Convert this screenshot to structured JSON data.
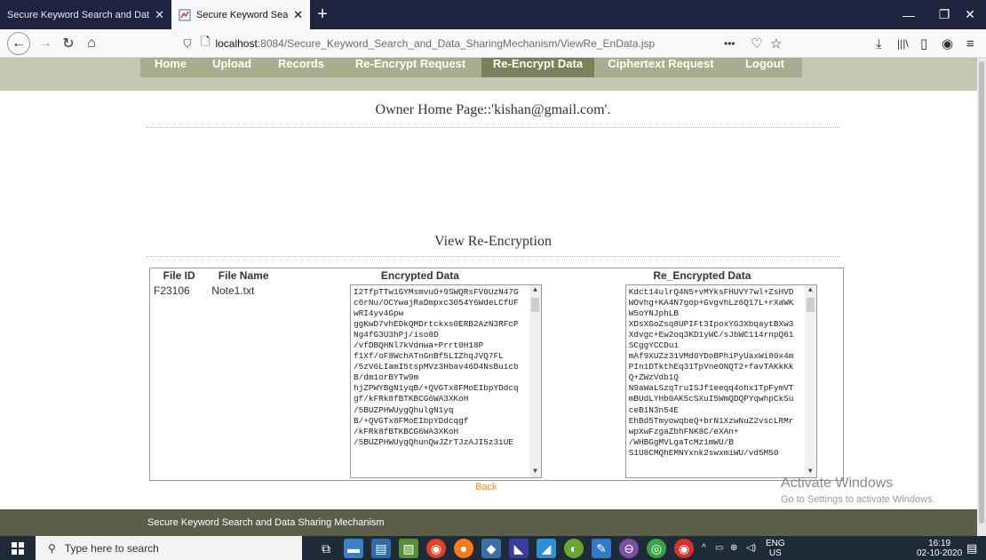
{
  "browser": {
    "tabs": [
      {
        "title": "Secure Keyword Search and Data Sh",
        "active": false
      },
      {
        "title": "Secure Keyword Search",
        "active": true
      }
    ],
    "url_host": "localhost",
    "url_rest": ":8084/Secure_Keyword_Search_and_Data_SharingMechanism/ViewRe_EnData.jsp",
    "more": "•••"
  },
  "menu": {
    "items": [
      {
        "label": "Home"
      },
      {
        "label": "Upload"
      },
      {
        "label": "Records"
      },
      {
        "label": "Re-Encrypt Request"
      },
      {
        "label": "Re-Encrypt Data",
        "selected": true
      },
      {
        "label": "Ciphertext Request"
      },
      {
        "label": "Logout"
      }
    ]
  },
  "page": {
    "owner_heading": "Owner Home Page::'kishan@gmail.com'.",
    "view_heading": "View Re-Encryption",
    "table": {
      "headers": [
        "File ID",
        "File Name",
        "Encrypted Data",
        "Re_Encrypted Data"
      ],
      "rows": [
        {
          "file_id": "F23106",
          "file_name": "Note1.txt",
          "encrypted": "I2TfpTTw1GYMsmvuO+9SWQRsFV0UzN47Gc6rNu/OCYwajRaDmpxc3054Y6WdeLCfUFwRI4yv4Gpw\nggKwD7vhEDkQMDrtckxs0ERB2AzN3RFcPNg4fG3U3hPj/iso8D\n/vfDBQHNl7kVdnwa+Prrt0H18P\nf1Xf/oF8WchATnGnBf5LIZhqJVQ7FL\n/5zV6LIamI5tspMVz3Hbav46D4NsBuicbB/dm1orBYTw9m\nhjZPWYBgN1yqB/+QVGTx8FMoEIbpYDdcqgf/kFRk8fBTKBCG6WA3XKoH\n/5BUZPHWUygQhulgN1yq\nB/+QVGTx8FMoEIbpYDdcqgf\n/kFRk8fBTKBCG6WA3XKoH\n/5BUZPHWUygQhunQwJZrTJzAJI5z3iUE",
          "re_encrypted": "Kdct14ulrQ4N5+vMYksFHUVY7wl+ZsHVDWOvhg+KA4N7gop+GvgvhLz6Q17L+rXaWKW5oYNJphLB\nXDsXGoZsq8UPIFt3IpoxYG3XbqaytBXw3Xdvgc+Ew2oq3KD1yWC/sJbWC114rnpQ61SCggYCCDui\nmAf9XUZz31VMd0YDoBPhiPyUaxWi80x4mPIn1DTkthEq31TpVneONQT2+favTAKkKkQ+ZWzVdb1Q\nN9aWaLSzqTruISJf1eeqq4ohx1TpFymVTmBUdLYHb0AK5cSXuI5WmQDQPYqwhpCkSuceB1N3n54E\nEhBd5TmyowqbeQ+brN1XzwNuZ2vscLRMrwpXwFzgaZbhFNK8C/eXAn+\n/WHBGgMVLgaTcMz1mWU/B\nS1U8CMQhEMNYxnk2swxmiWU/vd5M50"
        }
      ]
    },
    "back_label": "Back",
    "watermark_title": "Activate Windows",
    "watermark_sub": "Go to Settings to activate Windows.",
    "footer_text": "Secure Keyword Search and Data Sharing Mechanism"
  },
  "taskbar": {
    "search_placeholder": "Type here to search",
    "lang_top": "ENG",
    "lang_bottom": "US",
    "time": "16:19",
    "date": "02-10-2020"
  },
  "colors": {
    "menu_bg": "#c3c9b0",
    "menu_item": "#a7ad8e",
    "menu_selected": "#7a8059",
    "footer": "#5b5e48",
    "back_link": "#e88c1d"
  }
}
